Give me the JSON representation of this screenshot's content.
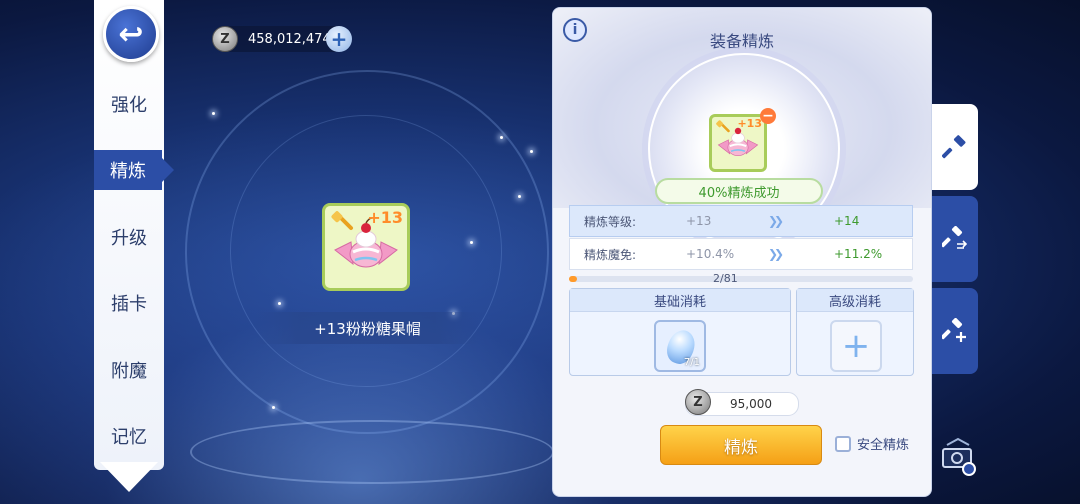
{
  "left_menu": {
    "back_icon": "back-arrow-icon",
    "items": [
      {
        "label": "强化",
        "active": false
      },
      {
        "label": "精炼",
        "active": true
      },
      {
        "label": "升级",
        "active": false
      },
      {
        "label": "插卡",
        "active": false
      },
      {
        "label": "附魔",
        "active": false
      },
      {
        "label": "记忆",
        "active": false
      }
    ]
  },
  "currency": {
    "icon": "zeny-coin-icon",
    "coin_glyph": "Z",
    "amount": "458,012,474",
    "add_icon": "plus-icon"
  },
  "item": {
    "level": "+13",
    "name": "+13粉粉糖果帽"
  },
  "panel": {
    "title": "装备精炼",
    "info_glyph": "i",
    "slot_level": "+13",
    "success_rate": "40%精炼成功",
    "stats": [
      {
        "label": "精炼等级:",
        "old": "+13",
        "new": "+14"
      },
      {
        "label": "精炼魔免:",
        "old": "+10.4%",
        "new": "+11.2%"
      }
    ],
    "progress": {
      "text": "2/81",
      "fraction": 0.0247
    },
    "basic_cost": {
      "title": "基础消耗",
      "material_count": "7/1"
    },
    "advanced_cost": {
      "title": "高级消耗"
    },
    "zeny_cost": "95,000",
    "refine_button": "精炼",
    "safe_refine_label": "安全精炼"
  },
  "side_tabs": [
    {
      "icon": "hammer-icon",
      "active": true
    },
    {
      "icon": "hammer-transfer-icon",
      "active": false
    },
    {
      "icon": "hammer-plus-icon",
      "active": false
    }
  ],
  "colors": {
    "accent": "#2c4ea6",
    "success": "#3e9a2e",
    "button": "#f5a016"
  }
}
